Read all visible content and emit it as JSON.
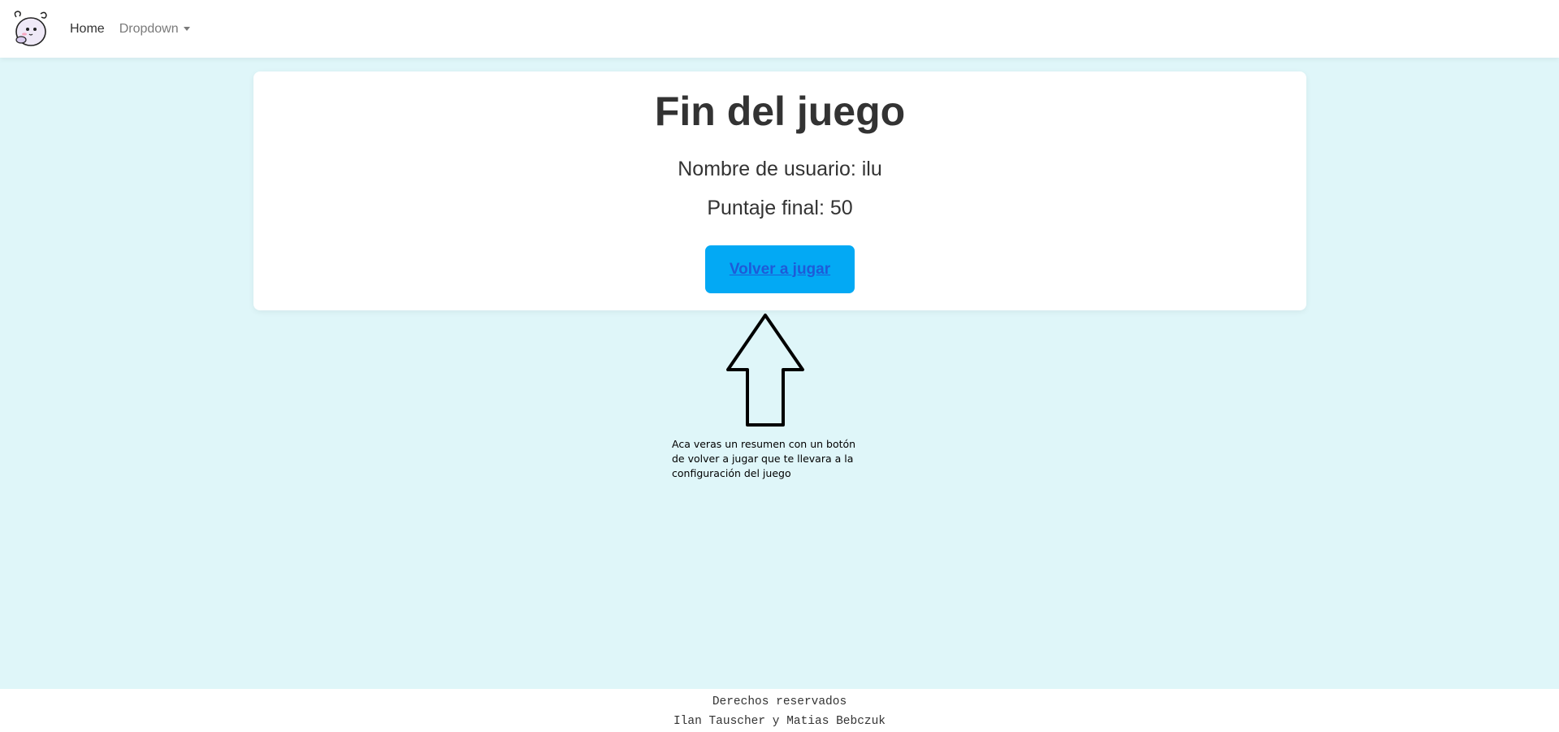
{
  "navbar": {
    "logo_icon": "mascot-logo-icon",
    "items": [
      {
        "label": "Home",
        "active": true
      },
      {
        "label": "Dropdown",
        "has_caret": true
      }
    ]
  },
  "card": {
    "title": "Fin del juego",
    "username_line": "Nombre de usuario: ilu",
    "score_line": "Puntaje final: 50",
    "button_label": "Volver a jugar"
  },
  "annotation": {
    "arrow_icon": "up-arrow-icon",
    "text": "Aca veras un resumen con un botón de volver a jugar que te llevara a la configuración del juego"
  },
  "footer": {
    "line1": "Derechos reservados",
    "line2": "Ilan Tauscher y Matias Bebczuk"
  },
  "colors": {
    "background": "#dff6f9",
    "button": "#03a9f4",
    "button_text": "#1e5bd8"
  }
}
